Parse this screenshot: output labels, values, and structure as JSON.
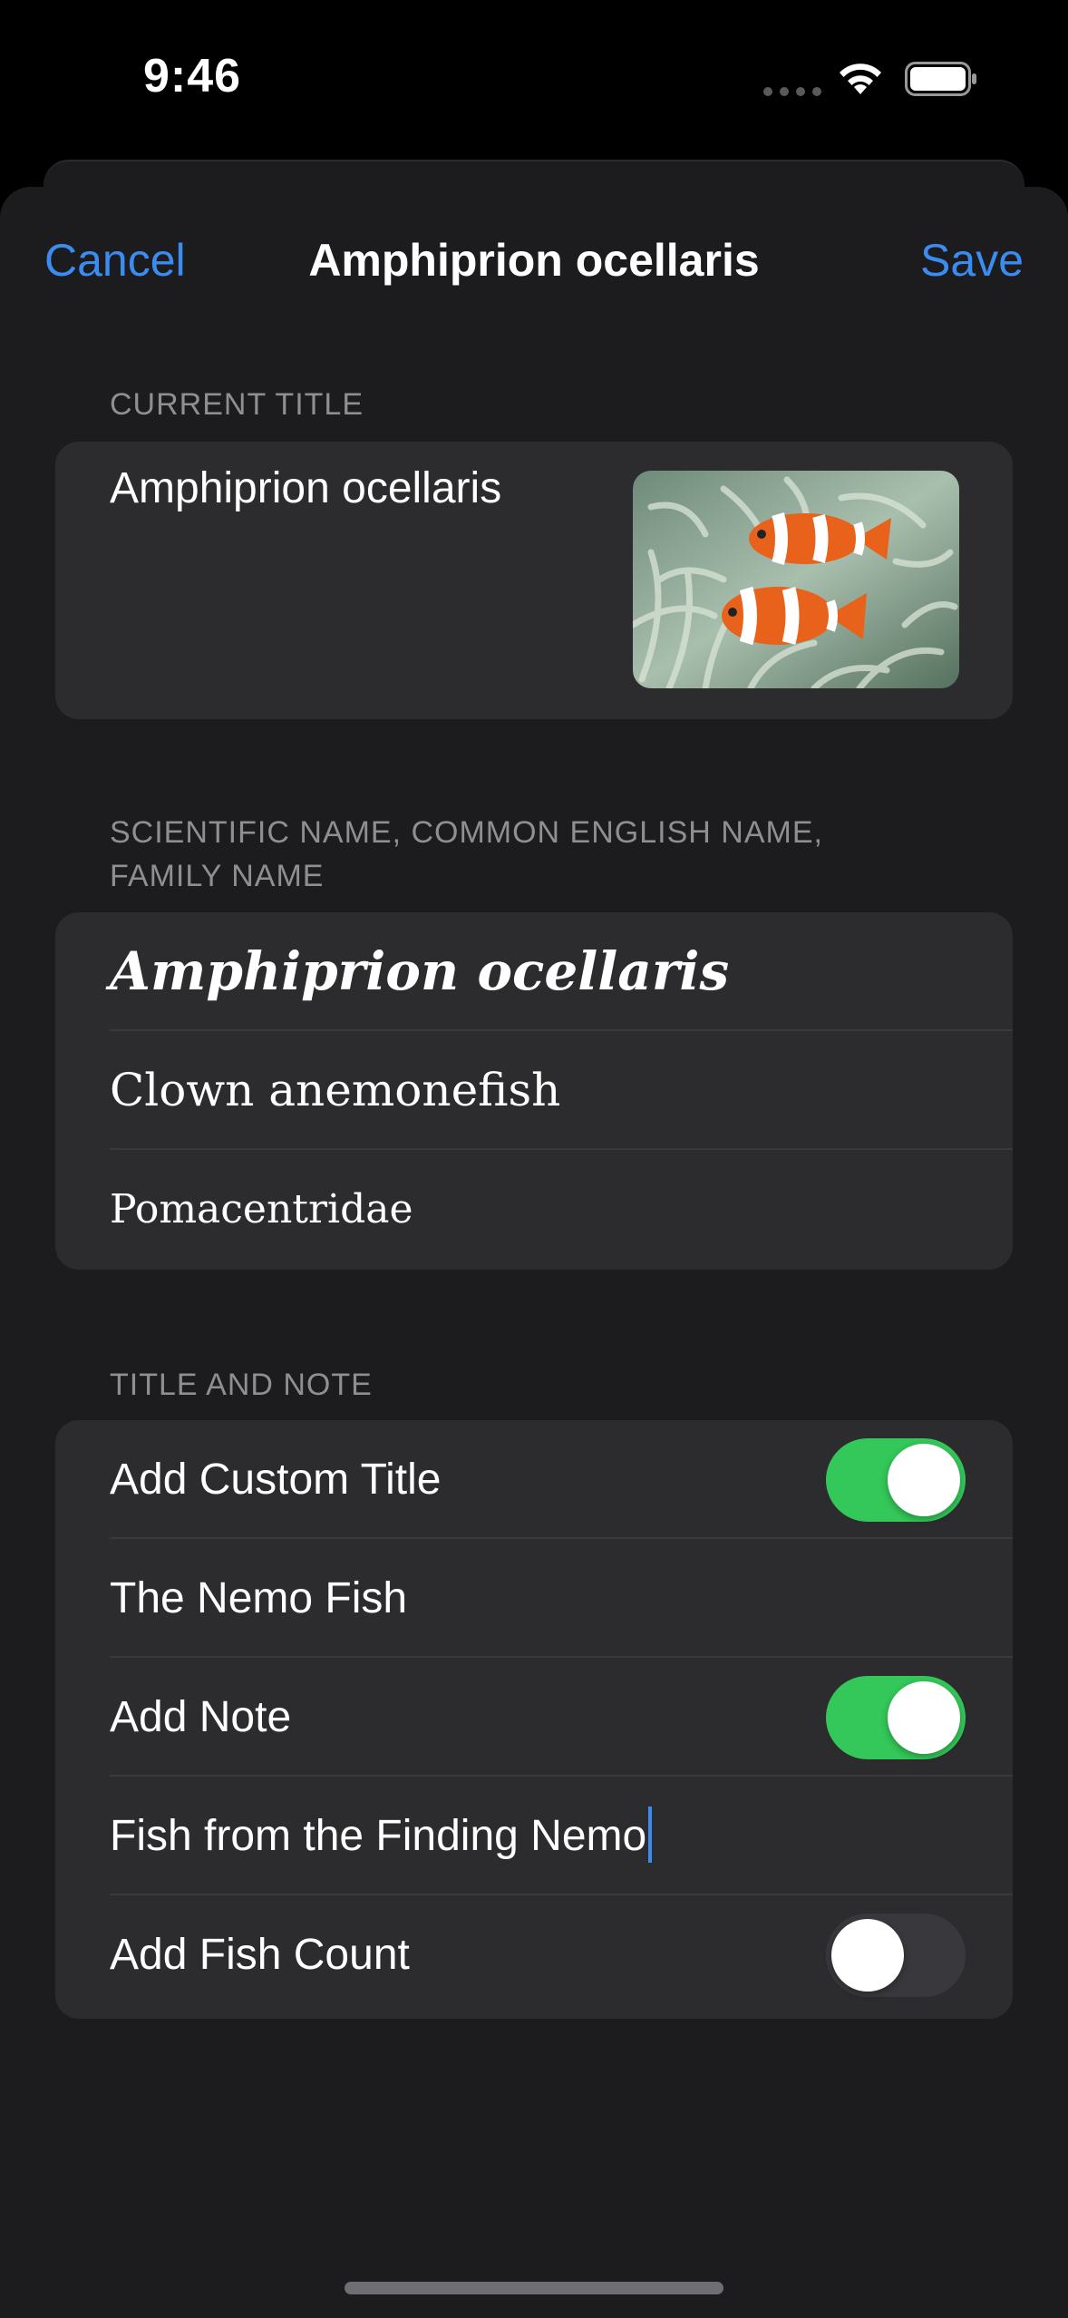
{
  "status_bar": {
    "time": "9:46"
  },
  "nav": {
    "cancel": "Cancel",
    "title": "Amphiprion ocellaris",
    "save": "Save"
  },
  "current_title": {
    "header": "CURRENT TITLE",
    "name": "Amphiprion ocellaris"
  },
  "names": {
    "header_line1": "SCIENTIFIC NAME, COMMON ENGLISH NAME,",
    "header_line2": "FAMILY NAME",
    "scientific": "Amphiprion ocellaris",
    "common": "Clown anemonefish",
    "family": "Pomacentridae"
  },
  "title_note": {
    "header": "TITLE AND NOTE",
    "add_custom_title": "Add Custom Title",
    "custom_title_on": true,
    "custom_title_value": "The Nemo Fish",
    "add_note": "Add Note",
    "add_note_on": true,
    "note_value": "Fish from the Finding Nemo",
    "add_fish_count": "Add Fish Count",
    "fish_count_on": false
  },
  "colors": {
    "accent": "#3b8cf0",
    "toggle_on": "#34c759",
    "toggle_off": "#39393d"
  }
}
